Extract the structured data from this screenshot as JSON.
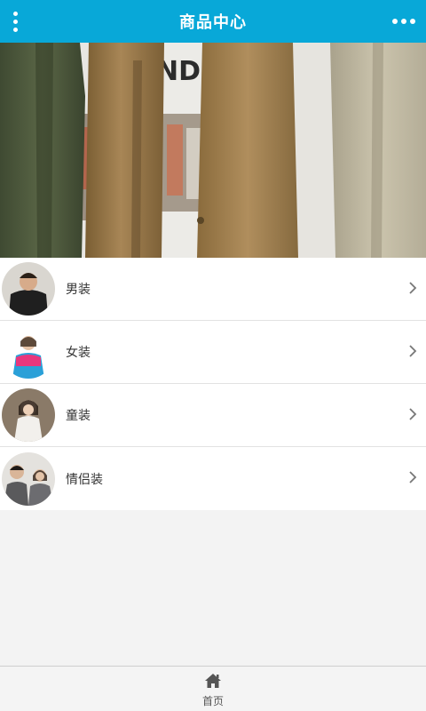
{
  "header": {
    "title": "商品中心"
  },
  "banner": {
    "slides": 1,
    "active_slide": 1
  },
  "categories": [
    {
      "label": "男装",
      "icon": "men-clothing-thumb"
    },
    {
      "label": "女装",
      "icon": "women-clothing-thumb"
    },
    {
      "label": "童装",
      "icon": "kids-clothing-thumb"
    },
    {
      "label": "情侣装",
      "icon": "couples-clothing-thumb"
    }
  ],
  "bottom_nav": {
    "home_label": "首页"
  },
  "colors": {
    "header_bg": "#08a8d8",
    "page_bg": "#f3f3f3"
  }
}
